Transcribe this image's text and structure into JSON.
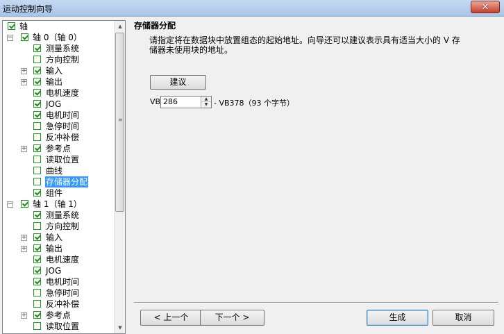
{
  "window": {
    "title": "运动控制向导",
    "close_glyph": "✕"
  },
  "tree": {
    "items": [
      {
        "level": 0,
        "expander": "",
        "checked": true,
        "label": "轴"
      },
      {
        "level": 1,
        "expander": "−",
        "checked": true,
        "label": "轴 0（轴 0）"
      },
      {
        "level": 2,
        "expander": "",
        "checked": true,
        "label": "测量系统"
      },
      {
        "level": 2,
        "expander": "",
        "checked": false,
        "label": "方向控制"
      },
      {
        "level": 2,
        "expander": "+",
        "checked": true,
        "label": "输入"
      },
      {
        "level": 2,
        "expander": "+",
        "checked": true,
        "label": "输出"
      },
      {
        "level": 2,
        "expander": "",
        "checked": true,
        "label": "电机速度"
      },
      {
        "level": 2,
        "expander": "",
        "checked": true,
        "label": "JOG"
      },
      {
        "level": 2,
        "expander": "",
        "checked": true,
        "label": "电机时间"
      },
      {
        "level": 2,
        "expander": "",
        "checked": false,
        "label": "急停时间"
      },
      {
        "level": 2,
        "expander": "",
        "checked": false,
        "label": "反冲补偿"
      },
      {
        "level": 2,
        "expander": "+",
        "checked": true,
        "label": "参考点"
      },
      {
        "level": 2,
        "expander": "",
        "checked": false,
        "label": "读取位置"
      },
      {
        "level": 2,
        "expander": "",
        "checked": false,
        "label": "曲线"
      },
      {
        "level": 2,
        "expander": "",
        "checked": false,
        "label": "存储器分配",
        "selected": true
      },
      {
        "level": 2,
        "expander": "",
        "checked": true,
        "label": "组件"
      },
      {
        "level": 1,
        "expander": "−",
        "checked": true,
        "label": "轴 1（轴 1）"
      },
      {
        "level": 2,
        "expander": "",
        "checked": true,
        "label": "测量系统"
      },
      {
        "level": 2,
        "expander": "",
        "checked": false,
        "label": "方向控制"
      },
      {
        "level": 2,
        "expander": "+",
        "checked": true,
        "label": "输入"
      },
      {
        "level": 2,
        "expander": "+",
        "checked": true,
        "label": "输出"
      },
      {
        "level": 2,
        "expander": "",
        "checked": true,
        "label": "电机速度"
      },
      {
        "level": 2,
        "expander": "",
        "checked": true,
        "label": "JOG"
      },
      {
        "level": 2,
        "expander": "",
        "checked": true,
        "label": "电机时间"
      },
      {
        "level": 2,
        "expander": "",
        "checked": false,
        "label": "急停时间"
      },
      {
        "level": 2,
        "expander": "",
        "checked": false,
        "label": "反冲补偿"
      },
      {
        "level": 2,
        "expander": "+",
        "checked": true,
        "label": "参考点"
      },
      {
        "level": 2,
        "expander": "",
        "checked": false,
        "label": "读取位置"
      }
    ],
    "scroll_grip": "≡",
    "scroll_up": "▲",
    "scroll_down": "▼"
  },
  "panel": {
    "heading": "存储器分配",
    "description_line1": "请指定将在数据块中放置组态的起始地址。向导还可以建议表示具有适当大小的 V 存",
    "description_line2": "储器未使用块的地址。",
    "suggest_label": "建议",
    "vb_label": "VB",
    "vb_value": "286",
    "vb_range": "- VB378（93 个字节）",
    "spin_up": "▲",
    "spin_down": "▼"
  },
  "footer": {
    "prev_label": "< 上一个",
    "next_label": "下一个 >",
    "generate_label": "生成",
    "cancel_label": "取消"
  }
}
